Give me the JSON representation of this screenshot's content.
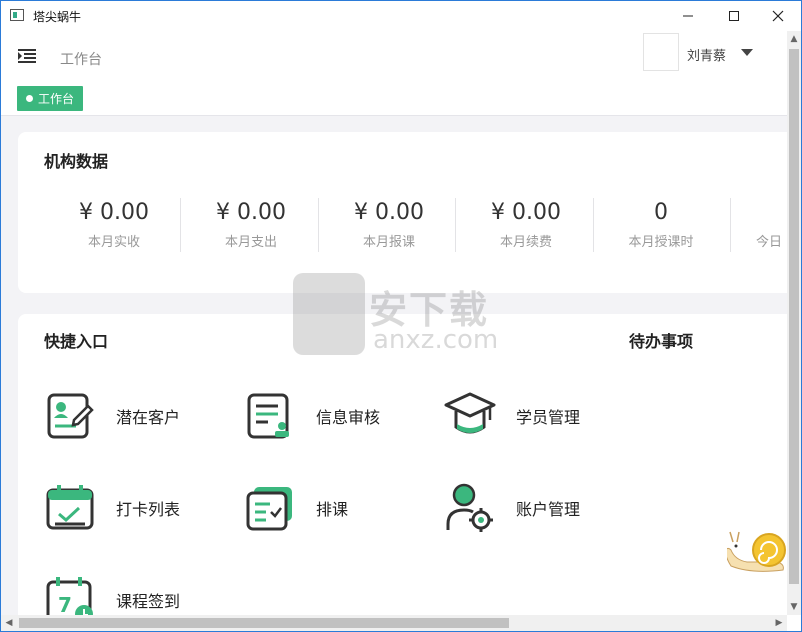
{
  "window": {
    "title": "塔尖蜗牛",
    "minimize_label": "—",
    "maximize_label": "☐",
    "close_label": "✕"
  },
  "header": {
    "breadcrumb": "工作台",
    "username": "刘青蔡"
  },
  "tags": [
    {
      "label": "工作台",
      "active": true
    }
  ],
  "org_data": {
    "title": "机构数据",
    "stats": [
      {
        "value": "¥ 0.00",
        "label": "本月实收"
      },
      {
        "value": "¥ 0.00",
        "label": "本月支出"
      },
      {
        "value": "¥ 0.00",
        "label": "本月报课"
      },
      {
        "value": "¥ 0.00",
        "label": "本月续费"
      },
      {
        "value": "0",
        "label": "本月授课时"
      },
      {
        "value": "",
        "label": "今日"
      }
    ]
  },
  "quick_entry": {
    "title": "快捷入口",
    "todo_title": "待办事项",
    "items": [
      {
        "label": "潜在客户",
        "icon": "potential-customer-icon"
      },
      {
        "label": "信息审核",
        "icon": "info-review-icon"
      },
      {
        "label": "学员管理",
        "icon": "student-management-icon"
      },
      {
        "label": "打卡列表",
        "icon": "checkin-list-icon"
      },
      {
        "label": "排课",
        "icon": "schedule-icon"
      },
      {
        "label": "账户管理",
        "icon": "account-management-icon"
      },
      {
        "label": "课程签到",
        "icon": "course-signin-icon"
      }
    ]
  },
  "watermark": {
    "text": "安下载",
    "sub": "anxz.com"
  },
  "colors": {
    "accent": "#3bb77e",
    "icon_stroke": "#333333"
  }
}
